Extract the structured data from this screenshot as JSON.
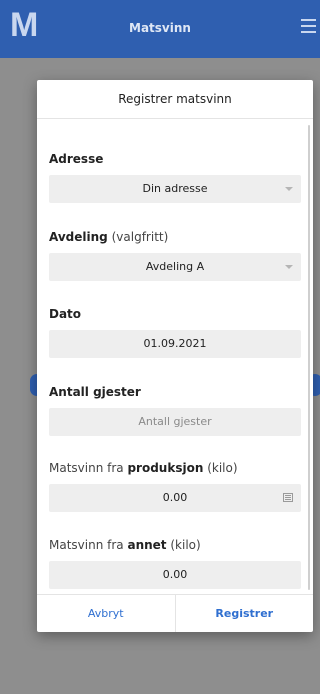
{
  "app": {
    "logo_letter": "M",
    "title": "Matsvinn",
    "brand_color": "#2f5fb0",
    "menu_icon": "hamburger-icon"
  },
  "modal": {
    "title": "Registrer matsvinn",
    "fields": {
      "address": {
        "label": "Adresse",
        "value": "Din adresse",
        "type": "select"
      },
      "department": {
        "label": "Avdeling",
        "label_suffix": "(valgfritt)",
        "value": "Avdeling A",
        "type": "select"
      },
      "date": {
        "label": "Dato",
        "value": "01.09.2021"
      },
      "guests": {
        "label": "Antall gjester",
        "placeholder": "Antall gjester"
      },
      "production": {
        "label_prefix": "Matsvinn fra",
        "label_bold": "produksjon",
        "label_suffix": "(kilo)",
        "value": "0.00",
        "icon": "calculator-icon"
      },
      "other": {
        "label_prefix": "Matsvinn fra",
        "label_bold": "annet",
        "label_suffix": "(kilo)",
        "value": "0.00"
      }
    },
    "buttons": {
      "cancel": "Avbryt",
      "submit": "Registrer"
    }
  }
}
